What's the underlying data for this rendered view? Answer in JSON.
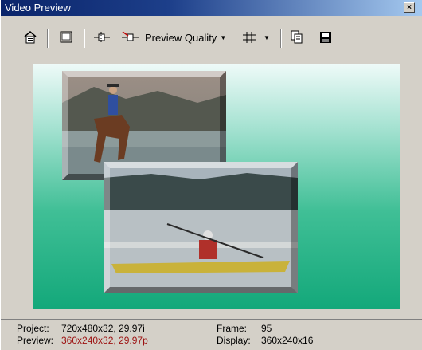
{
  "window": {
    "title": "Video Preview",
    "close_symbol": "×"
  },
  "toolbar": {
    "preview_quality_label": "Preview Quality",
    "dropdown_arrow": "▼",
    "icons": [
      "properties-icon",
      "monitor-icon",
      "previous-frame-icon",
      "split-icon",
      "grid-icon",
      "copy-icon",
      "save-icon"
    ]
  },
  "status": {
    "project_label": "Project:",
    "project_value": "720x480x32, 29.97i",
    "preview_label": "Preview:",
    "preview_value": "360x240x32, 29.97p",
    "frame_label": "Frame:",
    "frame_value": "95",
    "display_label": "Display:",
    "display_value": "360x240x16"
  },
  "colors": {
    "title_bar": "#0a246a",
    "preview_gradient_top": "#eefaf8",
    "preview_gradient_bottom": "#13a87a",
    "preview_value_text": "#9c1010"
  }
}
